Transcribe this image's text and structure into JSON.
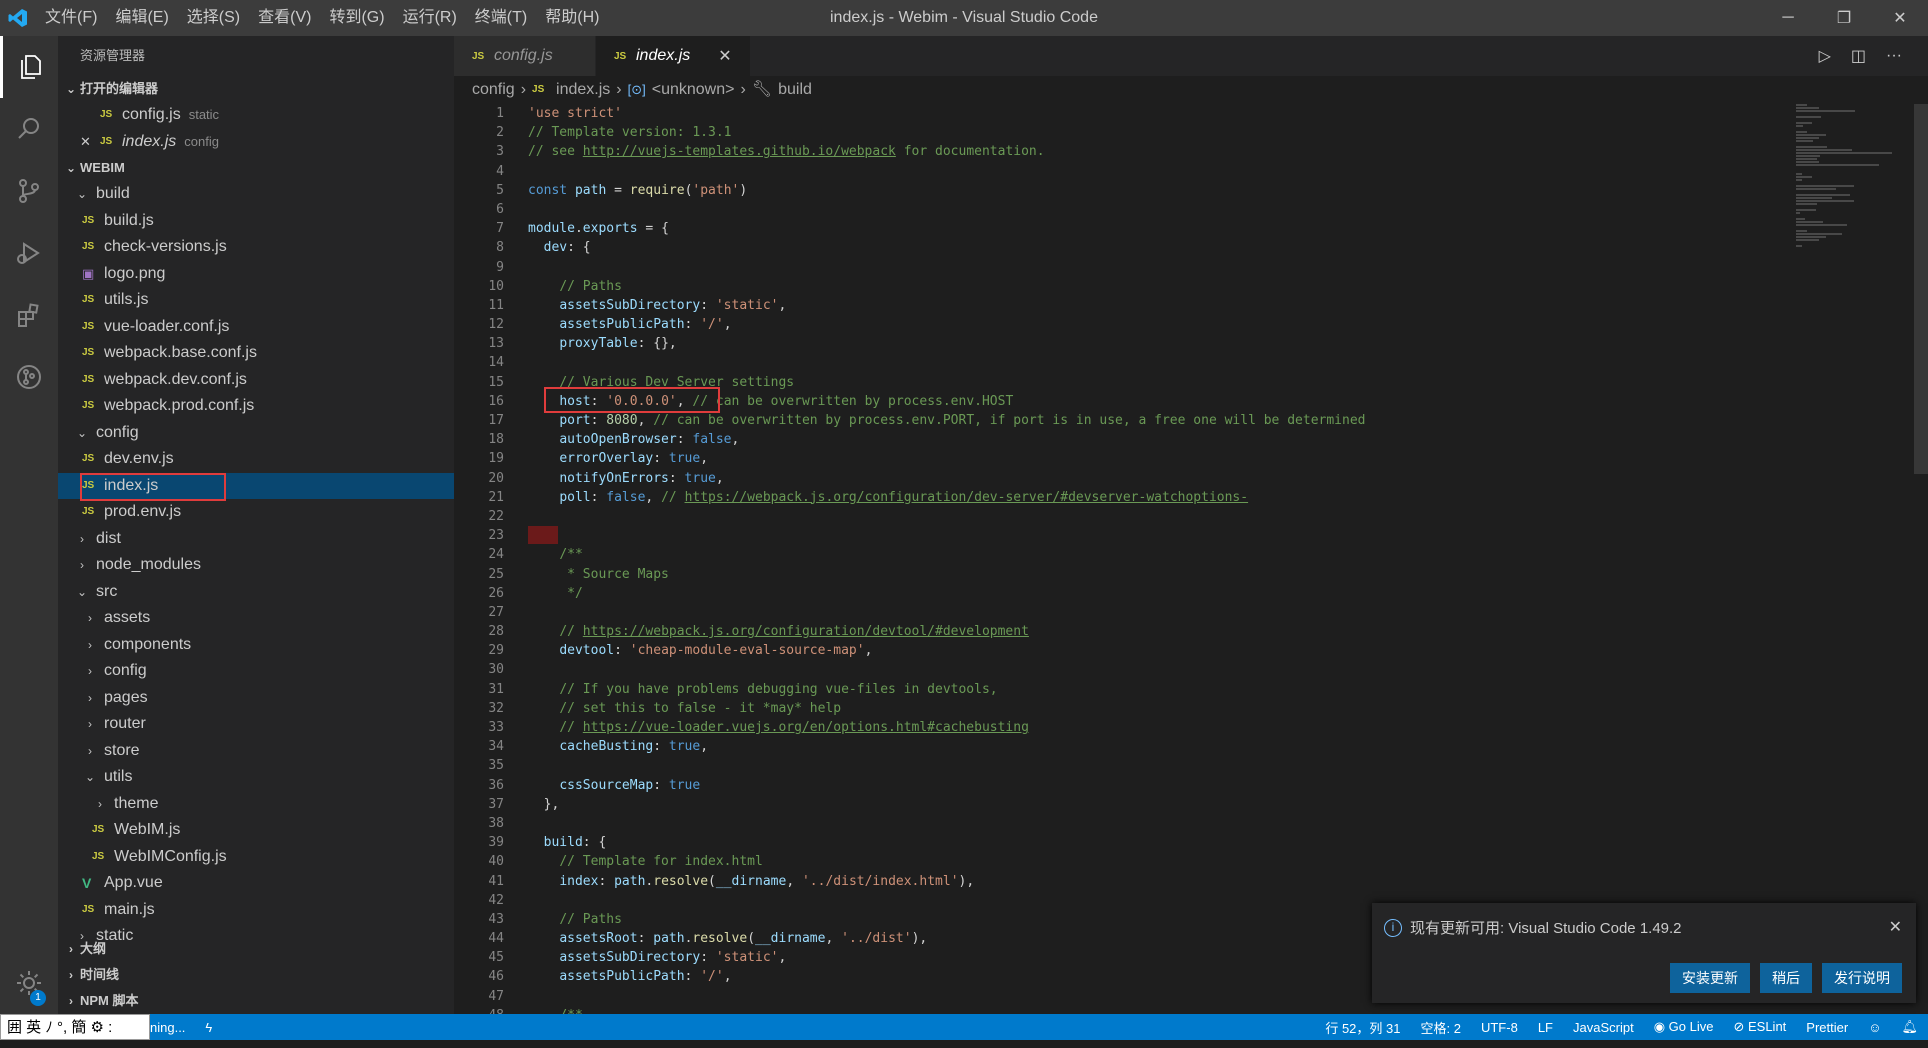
{
  "window": {
    "title": "index.js - Webim - Visual Studio Code",
    "menu": [
      "文件(F)",
      "编辑(E)",
      "选择(S)",
      "查看(V)",
      "转到(G)",
      "运行(R)",
      "终端(T)",
      "帮助(H)"
    ]
  },
  "sidebar": {
    "title": "资源管理器",
    "open_editors_label": "打开的编辑器",
    "open_editors": [
      {
        "name": "config.js",
        "desc": "static"
      },
      {
        "name": "index.js",
        "desc": "config"
      }
    ],
    "project_label": "WEBIM",
    "tree": [
      {
        "label": "build",
        "type": "folder-open",
        "depth": 1
      },
      {
        "label": "build.js",
        "type": "js",
        "depth": 2
      },
      {
        "label": "check-versions.js",
        "type": "js",
        "depth": 2
      },
      {
        "label": "logo.png",
        "type": "png",
        "depth": 2
      },
      {
        "label": "utils.js",
        "type": "js",
        "depth": 2
      },
      {
        "label": "vue-loader.conf.js",
        "type": "js",
        "depth": 2
      },
      {
        "label": "webpack.base.conf.js",
        "type": "js",
        "depth": 2
      },
      {
        "label": "webpack.dev.conf.js",
        "type": "js",
        "depth": 2
      },
      {
        "label": "webpack.prod.conf.js",
        "type": "js",
        "depth": 2
      },
      {
        "label": "config",
        "type": "folder-open",
        "depth": 1
      },
      {
        "label": "dev.env.js",
        "type": "js",
        "depth": 2
      },
      {
        "label": "index.js",
        "type": "js",
        "depth": 2
      },
      {
        "label": "prod.env.js",
        "type": "js",
        "depth": 2
      },
      {
        "label": "dist",
        "type": "folder",
        "depth": 1
      },
      {
        "label": "node_modules",
        "type": "folder",
        "depth": 1
      },
      {
        "label": "src",
        "type": "folder-open",
        "depth": 1
      },
      {
        "label": "assets",
        "type": "folder",
        "depth": 2
      },
      {
        "label": "components",
        "type": "folder",
        "depth": 2
      },
      {
        "label": "config",
        "type": "folder",
        "depth": 2
      },
      {
        "label": "pages",
        "type": "folder",
        "depth": 2
      },
      {
        "label": "router",
        "type": "folder",
        "depth": 2
      },
      {
        "label": "store",
        "type": "folder",
        "depth": 2
      },
      {
        "label": "utils",
        "type": "folder-open",
        "depth": 2
      },
      {
        "label": "theme",
        "type": "folder",
        "depth": 3
      },
      {
        "label": "WebIM.js",
        "type": "js",
        "depth": 3
      },
      {
        "label": "WebIMConfig.js",
        "type": "js",
        "depth": 3
      },
      {
        "label": "App.vue",
        "type": "vue",
        "depth": 2
      },
      {
        "label": "main.js",
        "type": "js",
        "depth": 2
      },
      {
        "label": "static",
        "type": "folder",
        "depth": 1
      }
    ],
    "outline_label": "大纲",
    "timeline_label": "时间线",
    "npm_label": "NPM 脚本"
  },
  "tabs": [
    {
      "label": "config.js",
      "active": false
    },
    {
      "label": "index.js",
      "active": true
    }
  ],
  "breadcrumb": [
    "config",
    "index.js",
    "<unknown>",
    "build"
  ],
  "code_lines": [
    "<span class=\"str\">'use strict'</span>",
    "<span class=\"cmt\">// Template version: 1.3.1</span>",
    "<span class=\"cmt\">// see </span><span class=\"url\">http://vuejs-templates.github.io/webpack</span><span class=\"cmt\"> for documentation.</span>",
    "",
    "<span class=\"kw\">const</span> <span class=\"prop\">path</span> = <span class=\"fn\">require</span>(<span class=\"str\">'path'</span>)",
    "",
    "<span class=\"prop\">module</span>.<span class=\"prop\">exports</span> = {",
    "  <span class=\"prop\">dev</span>: {",
    "",
    "    <span class=\"cmt\">// Paths</span>",
    "    <span class=\"prop\">assetsSubDirectory</span>: <span class=\"str\">'static'</span>,",
    "    <span class=\"prop\">assetsPublicPath</span>: <span class=\"str\">'/'</span>,",
    "    <span class=\"prop\">proxyTable</span>: {},",
    "",
    "    <span class=\"cmt\">// Various Dev Server settings</span>",
    "    <span class=\"prop\">host</span>: <span class=\"str\">'0.0.0.0'</span>, <span class=\"cmt\">// can be overwritten by process.env.HOST</span>",
    "    <span class=\"prop\">port</span>: <span class=\"num\">8080</span>, <span class=\"cmt\">// can be overwritten by process.env.PORT, if port is in use, a free one will be determined</span>",
    "    <span class=\"prop\">autoOpenBrowser</span>: <span class=\"kw\">false</span>,",
    "    <span class=\"prop\">errorOverlay</span>: <span class=\"kw\">true</span>,",
    "    <span class=\"prop\">notifyOnErrors</span>: <span class=\"kw\">true</span>,",
    "    <span class=\"prop\">poll</span>: <span class=\"kw\">false</span>, <span class=\"cmt\">// </span><span class=\"url\">https://webpack.js.org/configuration/dev-server/#devserver-watchoptions-</span>",
    "",
    "",
    "    <span class=\"cmt\">/**</span>",
    "<span class=\"cmt\">     * Source Maps</span>",
    "<span class=\"cmt\">     */</span>",
    "",
    "    <span class=\"cmt\">// </span><span class=\"url\">https://webpack.js.org/configuration/devtool/#development</span>",
    "    <span class=\"prop\">devtool</span>: <span class=\"str\">'cheap-module-eval-source-map'</span>,",
    "",
    "    <span class=\"cmt\">// If you have problems debugging vue-files in devtools,</span>",
    "    <span class=\"cmt\">// set this to false - it *may* help</span>",
    "    <span class=\"cmt\">// </span><span class=\"url\">https://vue-loader.vuejs.org/en/options.html#cachebusting</span>",
    "    <span class=\"prop\">cacheBusting</span>: <span class=\"kw\">true</span>,",
    "",
    "    <span class=\"prop\">cssSourceMap</span>: <span class=\"kw\">true</span>",
    "  },",
    "",
    "  <span class=\"prop\">build</span>: {",
    "    <span class=\"cmt\">// Template for index.html</span>",
    "    <span class=\"prop\">index</span>: <span class=\"prop\">path</span>.<span class=\"fn\">resolve</span>(<span class=\"prop\">__dirname</span>, <span class=\"str\">'../dist/index.html'</span>),",
    "",
    "    <span class=\"cmt\">// Paths</span>",
    "    <span class=\"prop\">assetsRoot</span>: <span class=\"prop\">path</span>.<span class=\"fn\">resolve</span>(<span class=\"prop\">__dirname</span>, <span class=\"str\">'../dist'</span>),",
    "    <span class=\"prop\">assetsSubDirectory</span>: <span class=\"str\">'static'</span>,",
    "    <span class=\"prop\">assetsPublicPath</span>: <span class=\"str\">'/'</span>,",
    "",
    "    <span class=\"cmt\">/**</span>"
  ],
  "notification": {
    "message": "现有更新可用: Visual Studio Code 1.49.2",
    "buttons": [
      "安装更新",
      "稍后",
      "发行说明"
    ]
  },
  "statusbar": {
    "left": "ning...",
    "ime": "囲 英 ﾉ °, 簡 ⚙ :",
    "position": "行 52，列 31",
    "spaces": "空格: 2",
    "encoding": "UTF-8",
    "eol": "LF",
    "language": "JavaScript",
    "golive": "Go Live",
    "eslint": "ESLint",
    "prettier": "Prettier"
  },
  "colors": {
    "accent": "#007acc",
    "highlight_box": "#e03c3c"
  }
}
